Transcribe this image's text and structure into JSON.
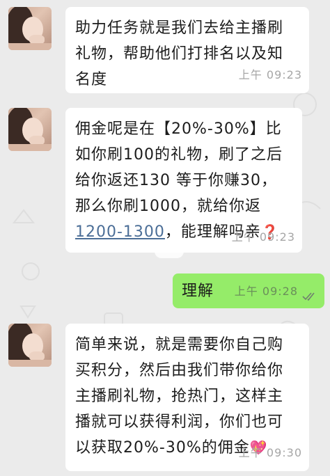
{
  "messages": [
    {
      "sender": "other",
      "text": "助力任务就是我们去给主播刷\n礼物，帮助他们打排名以及知\n名度",
      "time": "上午 09:23"
    },
    {
      "sender": "other",
      "text_before": "佣金呢是在【20%-30%】比\n如你刷100的礼物，刷了之后\n给你返还130 等于你赚30，\n那么你刷1000，就给你返\n",
      "link": "1200-1300",
      "text_after": "，能理解吗亲",
      "emoji": "❓",
      "time": "上午 09:23"
    },
    {
      "sender": "me",
      "text": "理解",
      "time": "上午 09:28",
      "status_icon": "double-check"
    },
    {
      "sender": "other",
      "text": "简单来说，就是需要你自己购\n买积分，然后由我们带你给你\n主播刷礼物，抢热门，这样主\n播就可以获得利润，你们也可\n以获取20%-30%的佣金",
      "emoji": "💖",
      "time": "上午 09:30"
    }
  ],
  "colors": {
    "background": "#ebebeb",
    "other_bubble": "#ffffff",
    "me_bubble": "#95ec69",
    "link": "#4b6e97",
    "timestamp": "#a6a6a6"
  }
}
